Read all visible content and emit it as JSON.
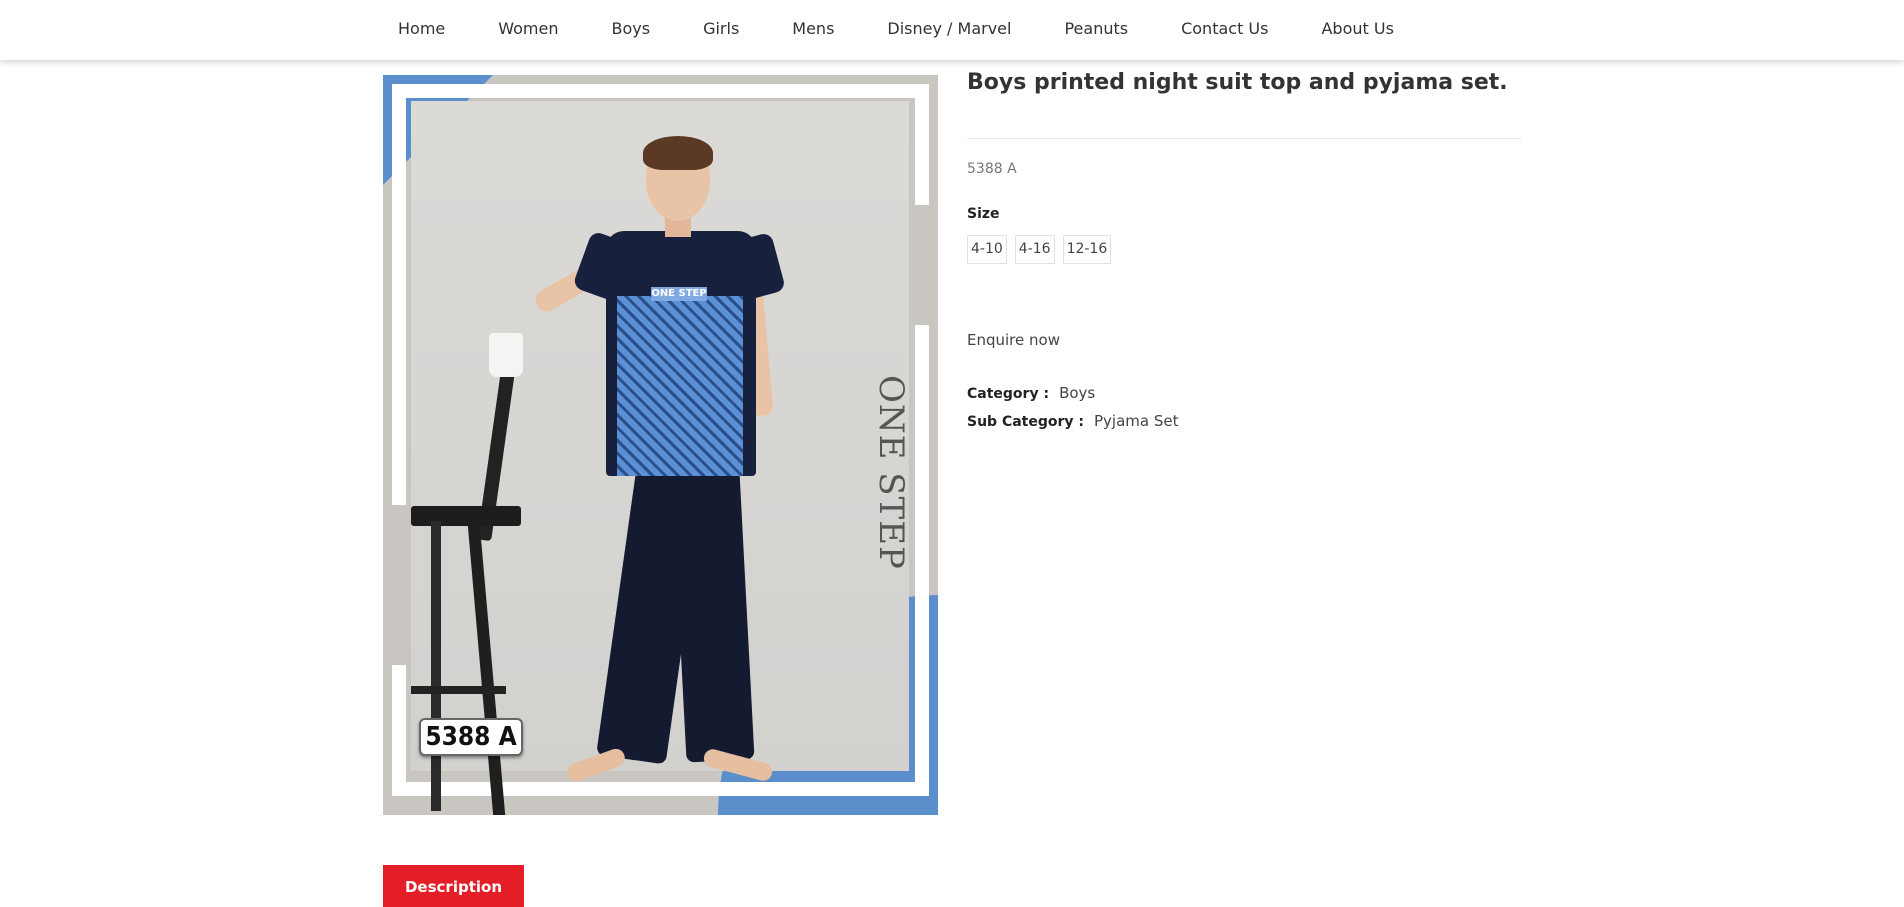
{
  "nav": {
    "items": [
      "Home",
      "Women",
      "Boys",
      "Girls",
      "Mens",
      "Disney / Marvel",
      "Peanuts",
      "Contact Us",
      "About Us"
    ]
  },
  "image": {
    "brand_text": "ONE STEP",
    "chest_text": "ONE STEP",
    "code_badge": "5388 A",
    "accent_color": "#5b8fcb"
  },
  "product": {
    "title": "Boys printed night suit top and pyjama set.",
    "sku": "5388 A",
    "size_label": "Size",
    "sizes": [
      "4-10",
      "4-16",
      "12-16"
    ],
    "enquire": "Enquire now",
    "category_key": "Category :",
    "category_value": "Boys",
    "subcategory_key": "Sub Category :",
    "subcategory_value": "Pyjama Set"
  },
  "tabs": {
    "description": "Description",
    "active_color": "#e41e26"
  }
}
